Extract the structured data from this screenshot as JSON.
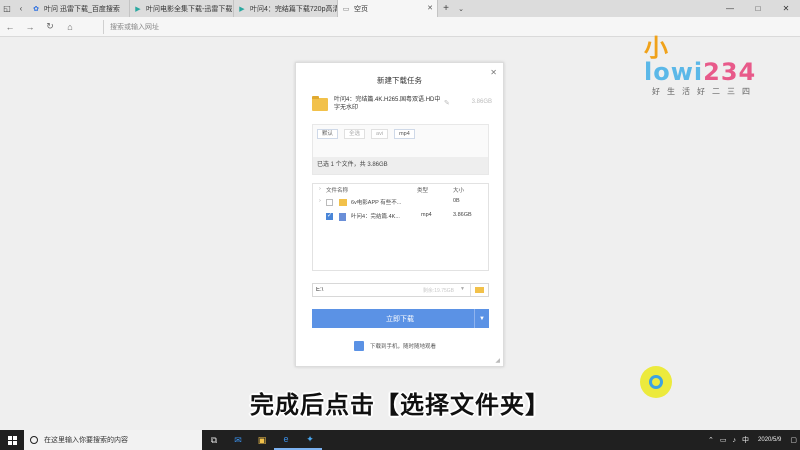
{
  "browser": {
    "tabs": [
      {
        "label": "叶问 迅雷下载_百度搜索",
        "favicon": "paw-icon"
      },
      {
        "label": "叶问电影全集下载-迅雷下载",
        "favicon": "play-icon"
      },
      {
        "label": "叶问4：完结篇下载720p高清",
        "favicon": "play-icon"
      },
      {
        "label": "空页",
        "favicon": "blank-page-icon"
      }
    ],
    "address_placeholder": "搜索或输入网址"
  },
  "logo": {
    "text_1": "小",
    "text_2": "lowi",
    "text_3": "234",
    "slogan": "好生活好二三四"
  },
  "dialog": {
    "title": "新建下载任务",
    "file_name": "叶问4：完结篇.4K.H265.国粤双语.HD中字无水印",
    "file_size": "3.86GB",
    "filters": [
      "默认",
      "全选",
      "avi",
      "mp4"
    ],
    "selected_info": "已选 1 个文件，共 3.86GB",
    "list_headers": {
      "name": "文件名称",
      "type": "类型",
      "size": "大小"
    },
    "list_rows": [
      {
        "name": "6v电影APP 有些不...",
        "type": "",
        "size": "0B",
        "checked": false,
        "kind": "folder"
      },
      {
        "name": "叶问4：完结篇.4K...",
        "type": "mp4",
        "size": "3.86GB",
        "checked": true,
        "kind": "video"
      }
    ],
    "path_value": "E:\\",
    "path_hint": "剩余:19.75GB",
    "download_label": "立即下载",
    "phone_label": "下载到手机，随时随地观看"
  },
  "subtitle": "完成后点击【选择文件夹】",
  "taskbar": {
    "search_placeholder": "在这里输入你要搜索的内容",
    "time": "",
    "date": "2020/5/9",
    "lang": "中"
  }
}
